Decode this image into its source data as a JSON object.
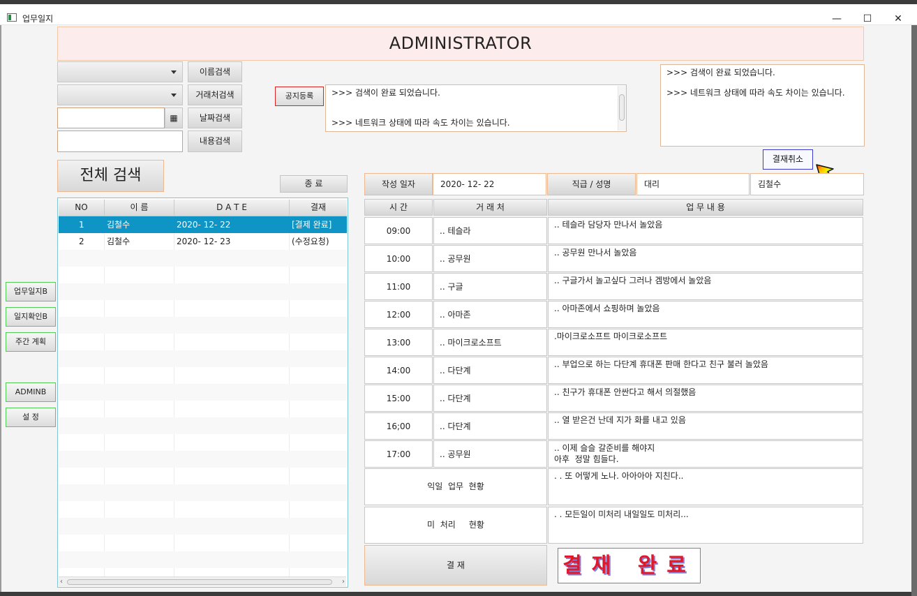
{
  "window": {
    "title": "업무일지",
    "minimize": "—",
    "maximize": "☐",
    "close": "✕"
  },
  "header": {
    "title": "ADMINISTRATOR"
  },
  "search": {
    "name_button": "이름검색",
    "client_button": "거래처검색",
    "date_button": "날짜검색",
    "content_button": "내용검색",
    "all_button": "전체 검색",
    "exit_button": "종 료",
    "calendar_icon": "▦"
  },
  "notice": {
    "register_button": "공지등록",
    "center_lines": [
      ">>> 검색이 완료 되었습니다.",
      "",
      ">>> 네트워크 상태에 따라 속도 차이는 있습니다."
    ],
    "right_lines": [
      ">>> 검색이 완료 되었습니다.",
      "",
      ">>> 네트워크 상태에 따라 속도 차이는 있습니다."
    ]
  },
  "sidebar": {
    "items": [
      {
        "label": "업무일지B"
      },
      {
        "label": "일지확인B"
      },
      {
        "label": "주간 계획"
      },
      {
        "label": "ADMINB"
      },
      {
        "label": "설   정"
      }
    ]
  },
  "list_table": {
    "headers": [
      "NO",
      "이   름",
      "D A T E",
      "결재"
    ],
    "rows": [
      {
        "no": "1",
        "name": "김철수",
        "date": "2020- 12- 22",
        "status": "[결제 완료]"
      },
      {
        "no": "2",
        "name": "김철수",
        "date": "2020- 12- 23",
        "status": "(수정요청)"
      }
    ]
  },
  "form": {
    "date_label": "작성 일자",
    "date_value": "2020- 12- 22",
    "rank_label": "직급 / 성명",
    "rank_value": "대리",
    "name_value": "김철수",
    "cancel_button": "결재취소",
    "col_time": "시   간",
    "col_client": "거 래 처",
    "col_task": "업          무          내          용",
    "rows": [
      {
        "time": "09:00",
        "client": ".. 테슬라",
        "task": ".. 테슬라 담당자 만나서 놀았음"
      },
      {
        "time": "10:00",
        "client": ".. 공무원",
        "task": ".. 공무원 만나서 놀았음"
      },
      {
        "time": "11:00",
        "client": ".. 구글",
        "task": ".. 구글가서 놀고싶다 그러나 겜방에서 놀았음"
      },
      {
        "time": "12:00",
        "client": ".. 아마존",
        "task": ".. 아마존에서 쇼핑하며 놀았음"
      },
      {
        "time": "13:00",
        "client": ".. 마이크로소프트",
        "task": ".마이크로소프트 마이크로소프트"
      },
      {
        "time": "14:00",
        "client": ".. 다단계",
        "task": ".. 부업으로 하는 다단계 휴대폰 판매 한다고 친구 불러 놀았음"
      },
      {
        "time": "15:00",
        "client": ".. 다단계",
        "task": ".. 친구가 휴대폰 안싼다고 해서 의절했음"
      },
      {
        "time": "16;00",
        "client": ".. 다단계",
        "task": ".. 열 받은건 난데 지가 화를 내고 있음"
      },
      {
        "time": "17:00",
        "client": ".. 공무원",
        "task": ".. 이제 슬슬 갈준비를 해야지\n아후  정말 힘들다."
      }
    ],
    "tomorrow_label": "익일  업무  현황",
    "tomorrow_text": ". . 또 어떻게 노나. 아아아아 지친다..",
    "pending_label": "미  처리     현황",
    "pending_text": ". . 모든일이 미처리 내일일도 미처리...",
    "approve_button": "결 재",
    "approve_stamp": "결재 완료"
  }
}
